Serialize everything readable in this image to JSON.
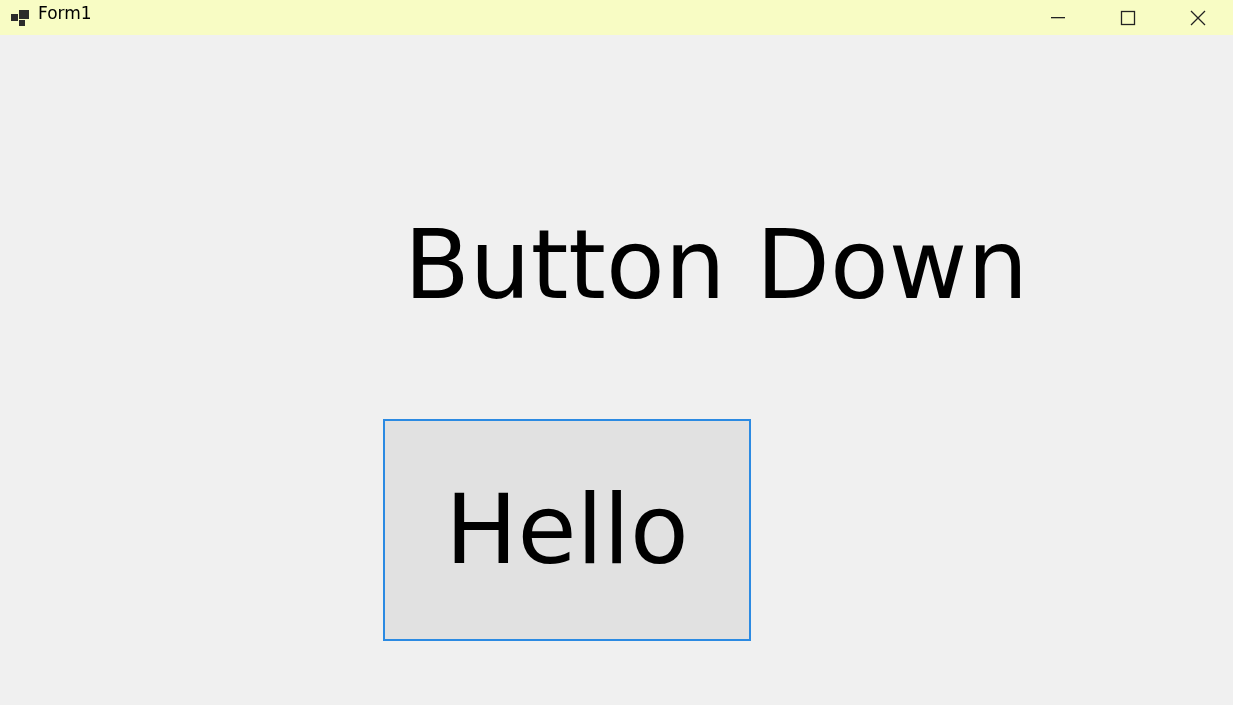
{
  "window": {
    "title": "Form1"
  },
  "label": {
    "text": "Button Down"
  },
  "button": {
    "label": "Hello",
    "focused": true
  }
}
